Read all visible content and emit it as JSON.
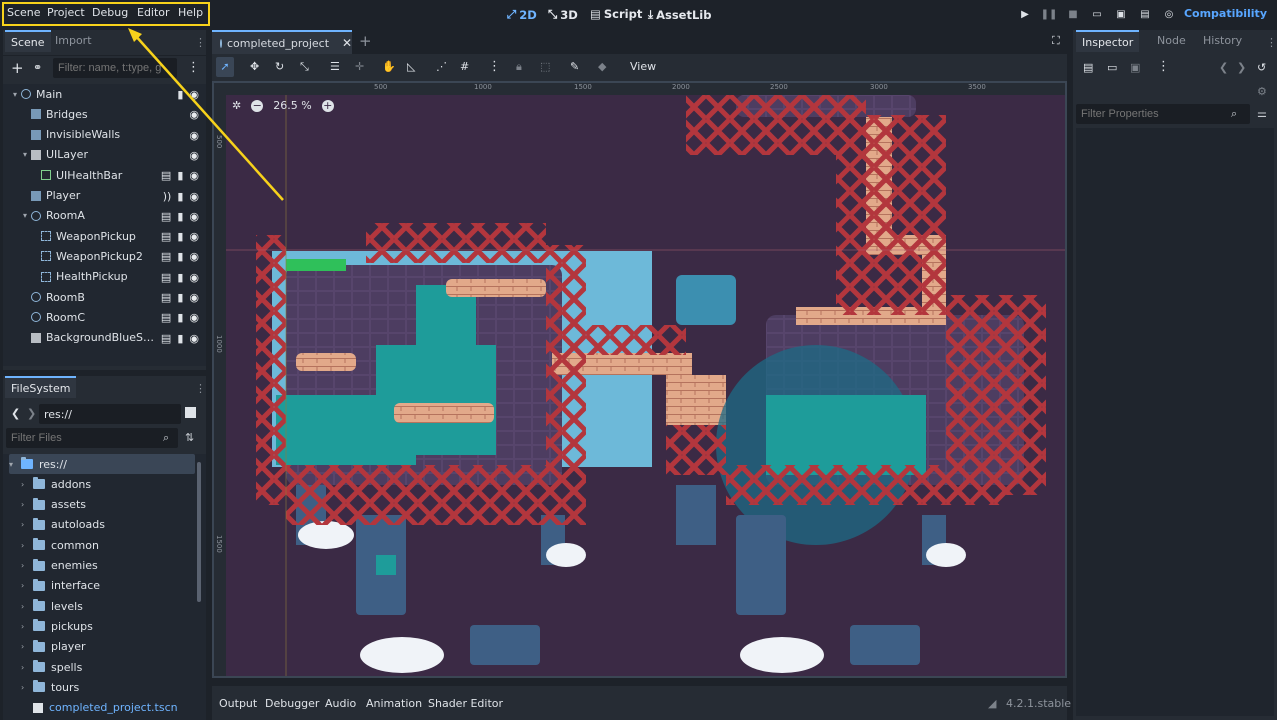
{
  "menu": [
    "Scene",
    "Project",
    "Debug",
    "Editor",
    "Help"
  ],
  "workspaces": [
    {
      "label": "2D",
      "icon": "2d-icon",
      "active": true
    },
    {
      "label": "3D",
      "icon": "3d-icon",
      "active": false
    },
    {
      "label": "Script",
      "icon": "script-icon",
      "active": false
    },
    {
      "label": "AssetLib",
      "icon": "assetlib-icon",
      "active": false
    }
  ],
  "renderer": "Compatibility",
  "scene_panel": {
    "tabs": [
      "Scene",
      "Import"
    ],
    "filter_placeholder": "Filter: name, t:type, g",
    "nodes": [
      {
        "label": "Main",
        "icon": "node2d-icon",
        "depth": 0,
        "expanded": true
      },
      {
        "label": "Bridges",
        "icon": "tilemap-icon",
        "depth": 1
      },
      {
        "label": "InvisibleWalls",
        "icon": "tilemap-icon",
        "depth": 1
      },
      {
        "label": "UILayer",
        "icon": "canvaslayer-icon",
        "depth": 1,
        "expanded": true
      },
      {
        "label": "UIHealthBar",
        "icon": "control-icon",
        "depth": 2
      },
      {
        "label": "Player",
        "icon": "characterbody-icon",
        "depth": 1
      },
      {
        "label": "RoomA",
        "icon": "node2d-icon",
        "depth": 1,
        "expanded": true
      },
      {
        "label": "WeaponPickup",
        "icon": "area2d-icon",
        "depth": 2
      },
      {
        "label": "WeaponPickup2",
        "icon": "area2d-icon",
        "depth": 2
      },
      {
        "label": "HealthPickup",
        "icon": "area2d-icon",
        "depth": 2
      },
      {
        "label": "RoomB",
        "icon": "node2d-icon",
        "depth": 1
      },
      {
        "label": "RoomC",
        "icon": "node2d-icon",
        "depth": 1
      },
      {
        "label": "BackgroundBlueS…",
        "icon": "parallax-icon",
        "depth": 1
      }
    ]
  },
  "filesystem": {
    "title": "FileSystem",
    "path": "res://",
    "filter_placeholder": "Filter Files",
    "root": "res://",
    "folders": [
      "addons",
      "assets",
      "autoloads",
      "common",
      "enemies",
      "interface",
      "levels",
      "pickups",
      "player",
      "spells",
      "tours"
    ],
    "file": "completed_project.tscn"
  },
  "editor": {
    "scene_tab": "completed_project",
    "zoom": "26.5 %",
    "view_label": "View",
    "ruler_ticks": [
      "500",
      "1000",
      "1500",
      "2000",
      "2500",
      "3000",
      "3500"
    ],
    "ruler_ticks_v": [
      "500",
      "1000",
      "1500"
    ]
  },
  "bottom_panel": {
    "tabs": [
      "Output",
      "Debugger",
      "Audio",
      "Animation",
      "Shader Editor"
    ],
    "version": "4.2.1.stable"
  },
  "inspector": {
    "tabs": [
      "Inspector",
      "Node",
      "History"
    ],
    "filter_placeholder": "Filter Properties"
  },
  "colors": {
    "accent": "#6fb4ff",
    "highlight": "#f7d21b",
    "viewport_bg": "#3b2a45",
    "cross": "#b3363d",
    "water": "#1e9c9a",
    "sky": "#6db9d9"
  }
}
